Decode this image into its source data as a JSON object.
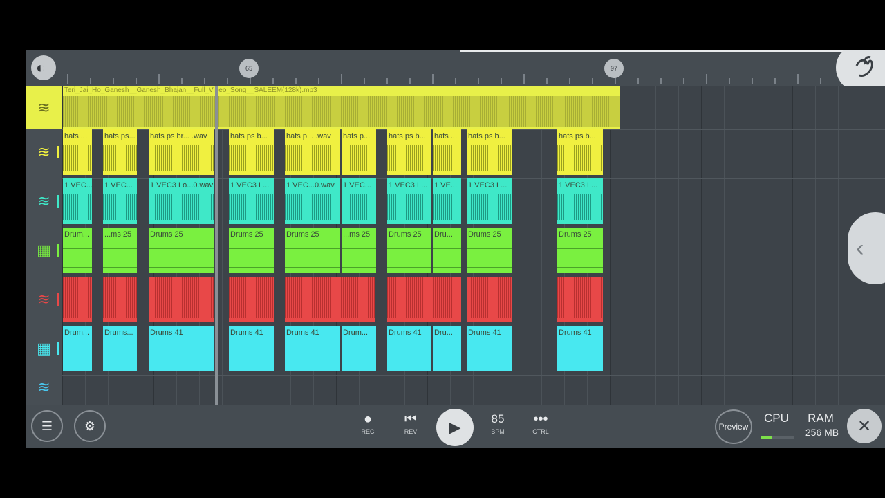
{
  "colors": {
    "audio": "#e8f04a",
    "hats": "#f0f040",
    "vec": "#3fe8c8",
    "drums25": "#7af040",
    "red": "#e84848",
    "drums41": "#48e8f0"
  },
  "topbar": {
    "logo_icon": "fl-studio-menu-icon",
    "marker_1": "65",
    "marker_2": "97",
    "fruit_logo_icon": "fl-fruit-logo-icon"
  },
  "audio_track": {
    "icon": "waveform-icon",
    "label": "Teri_Jai_Ho_Ganesh__Ganesh_Bhajan__Full_Video_Song__SALEEM(128k).mp3"
  },
  "tracks": [
    {
      "name": "hats",
      "icon": "waveform-icon",
      "color": "#f0f040",
      "clips": [
        {
          "label": "hats ..."
        },
        {
          "label": "hats ps..."
        },
        {
          "label": "hats ps br... .wav"
        },
        {
          "label": "hats ps b..."
        },
        {
          "label": "hats p... .wav"
        },
        {
          "label": "hats p..."
        },
        {
          "label": "hats ps b..."
        },
        {
          "label": "hats ..."
        },
        {
          "label": "hats ps b..."
        },
        {
          "label": "hats ps b..."
        }
      ]
    },
    {
      "name": "vec",
      "icon": "waveform-icon",
      "color": "#3fe8c8",
      "clips": [
        {
          "label": "1 VEC..."
        },
        {
          "label": "1 VEC..."
        },
        {
          "label": "1 VEC3 Lo...0.wav"
        },
        {
          "label": "1 VEC3 L..."
        },
        {
          "label": "1 VEC...0.wav"
        },
        {
          "label": "1 VEC..."
        },
        {
          "label": "1 VEC3 L..."
        },
        {
          "label": "1 VE..."
        },
        {
          "label": "1 VEC3 L..."
        },
        {
          "label": "1 VEC3 L..."
        }
      ]
    },
    {
      "name": "drums25",
      "icon": "pattern-grid-icon",
      "color": "#7af040",
      "clips": [
        {
          "label": "Drum..."
        },
        {
          "label": "...ms 25"
        },
        {
          "label": "Drums 25"
        },
        {
          "label": "Drums 25"
        },
        {
          "label": "Drums 25"
        },
        {
          "label": "...ms 25"
        },
        {
          "label": "Drums 25"
        },
        {
          "label": "Dru..."
        },
        {
          "label": "Drums 25"
        },
        {
          "label": "Drums 25"
        }
      ]
    },
    {
      "name": "red",
      "icon": "waveform-icon",
      "color": "#e84848",
      "clips": [
        {
          "label": ""
        },
        {
          "label": ""
        },
        {
          "label": ""
        },
        {
          "label": ""
        },
        {
          "label": ""
        },
        {
          "label": ""
        },
        {
          "label": ""
        },
        {
          "label": ""
        },
        {
          "label": ""
        }
      ]
    },
    {
      "name": "drums41",
      "icon": "pattern-grid-icon",
      "color": "#48e8f0",
      "clips": [
        {
          "label": "Drum..."
        },
        {
          "label": "Drums..."
        },
        {
          "label": "Drums 41"
        },
        {
          "label": "Drums 41"
        },
        {
          "label": "Drums 41"
        },
        {
          "label": "Drum..."
        },
        {
          "label": "Drums 41"
        },
        {
          "label": "Dru..."
        },
        {
          "label": "Drums 41"
        },
        {
          "label": "Drums 41"
        }
      ]
    }
  ],
  "empty_track_icon": "waveform-icon",
  "bottombar": {
    "mixer_icon": "mixer-sliders-icon",
    "settings_icon": "piano-settings-icon",
    "rec_label": "REC",
    "rev_label": "REV",
    "bpm_value": "85",
    "bpm_label": "BPM",
    "ctrl_label": "CTRL",
    "preview_label": "Preview",
    "cpu_label": "CPU",
    "cpu_level": 0.35,
    "ram_label": "RAM",
    "ram_value": "256 MB"
  }
}
